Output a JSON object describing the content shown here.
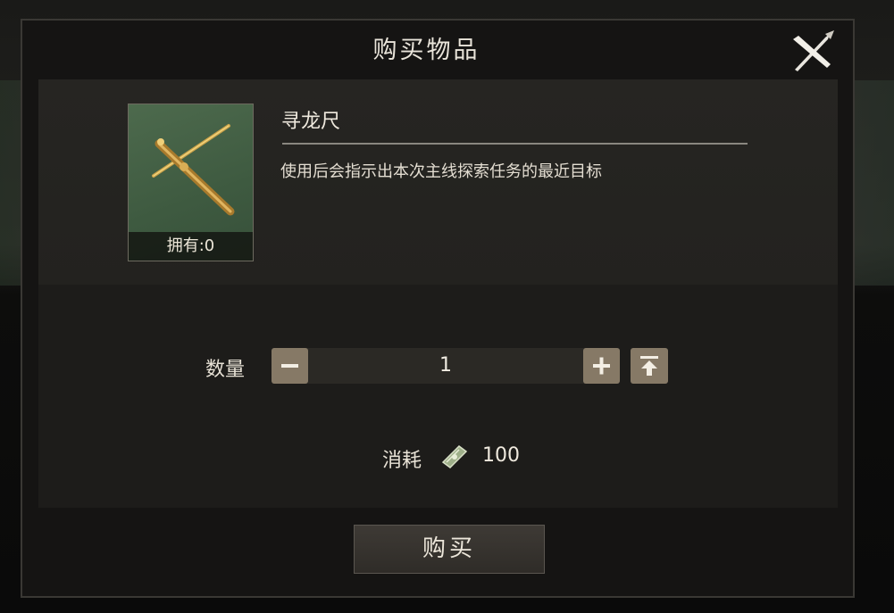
{
  "dialog": {
    "title": "购买物品",
    "close_icon": "close-x-icon"
  },
  "item": {
    "name": "寻龙尺",
    "description": "使用后会指示出本次主线探索任务的最近目标",
    "owned_label": "拥有:0",
    "icon": "dragon-ruler-item-icon"
  },
  "quantity": {
    "label": "数量",
    "value": "1",
    "minus_icon": "minus-icon",
    "plus_icon": "plus-icon",
    "max_icon": "max-quantity-icon"
  },
  "cost": {
    "label": "消耗",
    "icon": "currency-note-icon",
    "value": "100"
  },
  "buy_button": {
    "label": "购买"
  }
}
